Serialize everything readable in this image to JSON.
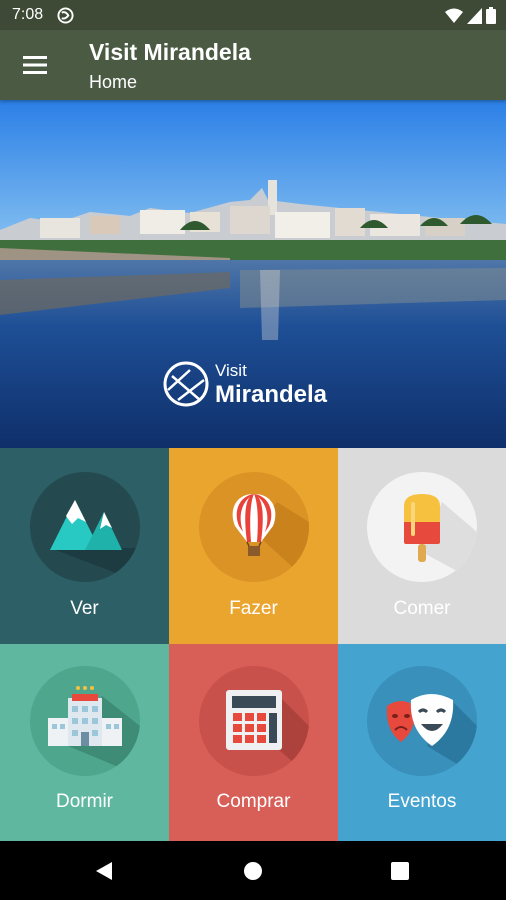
{
  "status_bar": {
    "time": "7:08",
    "icons": [
      "app-notification-icon",
      "wifi-icon",
      "signal-icon",
      "battery-icon"
    ]
  },
  "app_bar": {
    "title": "Visit Mirandela",
    "subtitle": "Home",
    "menu_icon": "hamburger-menu-icon",
    "background": "#4b5a43"
  },
  "hero": {
    "logo_small": "Visit",
    "logo_large": "Mirandela"
  },
  "tiles": [
    {
      "label": "Ver",
      "icon": "mountains-icon",
      "color": "#2d5f66"
    },
    {
      "label": "Fazer",
      "icon": "hot-air-balloon-icon",
      "color": "#eaa52e"
    },
    {
      "label": "Comer",
      "icon": "popsicle-icon",
      "color": "#dbdbdb"
    },
    {
      "label": "Dormir",
      "icon": "hotel-icon",
      "color": "#5fb79f"
    },
    {
      "label": "Comprar",
      "icon": "calculator-icon",
      "color": "#d85e58"
    },
    {
      "label": "Eventos",
      "icon": "theater-masks-icon",
      "color": "#45a3cf"
    }
  ],
  "nav_bar": {
    "icons": [
      "back-icon",
      "home-icon",
      "recents-icon"
    ]
  }
}
